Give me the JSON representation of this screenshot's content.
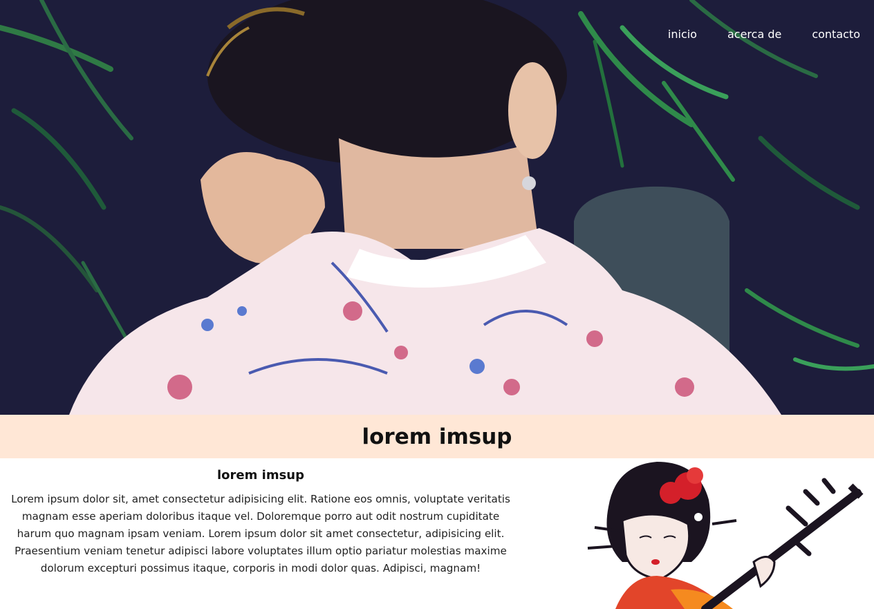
{
  "nav": {
    "items": [
      {
        "label": "inicio"
      },
      {
        "label": "acerca de"
      },
      {
        "label": "contacto"
      }
    ]
  },
  "banner": {
    "title": "lorem imsup"
  },
  "section": {
    "heading": "lorem imsup",
    "body": "Lorem ipsum dolor sit, amet consectetur adipisicing elit. Ratione eos omnis, voluptate veritatis magnam esse aperiam doloribus itaque vel. Doloremque porro aut odit nostrum cupiditate harum quo magnam ipsam veniam. Lorem ipsum dolor sit amet consectetur, adipisicing elit. Praesentium veniam tenetur adipisci labore voluptates illum optio pariatur molestias maxime dolorum excepturi possimus itaque, corporis in modi dolor quas. Adipisci, magnam!"
  },
  "colors": {
    "banner_bg": "#ffe7d6",
    "hero_bg": "#1e1e3a",
    "nav_text": "#ffffff"
  },
  "icons": {
    "hero": "kimono-woman-photo",
    "illustration": "geisha-shamisen-illustration"
  }
}
